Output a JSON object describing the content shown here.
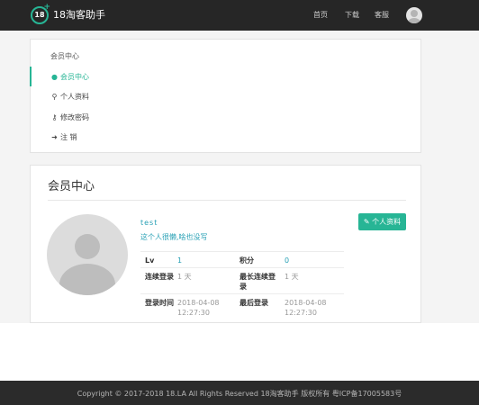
{
  "header": {
    "logo_badge": "18",
    "logo_plus": "+",
    "logo_text": "18淘客助手",
    "nav": [
      "首页",
      "下载",
      "客服"
    ]
  },
  "sidebar": {
    "title": "会员中心",
    "items": [
      {
        "label": "会员中心",
        "icon": "user-circle-icon",
        "active": true
      },
      {
        "label": "个人资料",
        "icon": "user-icon",
        "active": false
      },
      {
        "label": "修改密码",
        "icon": "key-icon",
        "active": false
      },
      {
        "label": "注 销",
        "icon": "sign-out-icon",
        "active": false
      }
    ]
  },
  "profile": {
    "title": "会员中心",
    "username": "test",
    "signature": "这个人很懒,啥也没写",
    "edit_button": "个人资料",
    "stats": {
      "lv_label": "Lv",
      "lv_value": "1",
      "points_label": "积分",
      "points_value": "0",
      "streak_label": "连续登录",
      "streak_value": "1 天",
      "max_streak_label": "最长连续登录",
      "max_streak_value": "1 天",
      "login_time_label": "登录时间",
      "login_time_value": "2018-04-08 12:27:30",
      "last_login_label": "最后登录",
      "last_login_value": "2018-04-08 12:27:30"
    }
  },
  "footer": {
    "text": "Copyright © 2017-2018 18.LA All Rights Reserved 18淘客助手 版权所有 粤ICP备17005583号"
  },
  "colors": {
    "accent": "#27b595",
    "link": "#27a0b5",
    "topbar": "#262626",
    "footer": "#2b2b2b"
  }
}
